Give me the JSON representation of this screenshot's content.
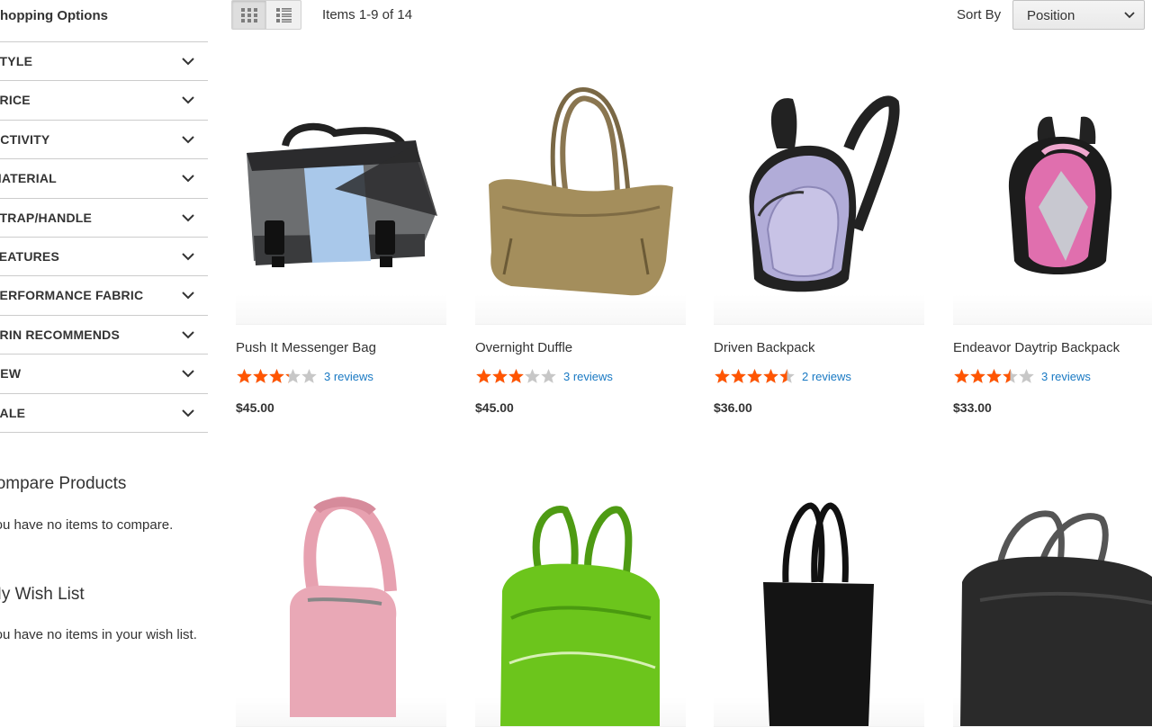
{
  "sidebar": {
    "title": "Shopping Options",
    "filters": [
      {
        "label": "STYLE"
      },
      {
        "label": "PRICE"
      },
      {
        "label": "ACTIVITY"
      },
      {
        "label": "MATERIAL"
      },
      {
        "label": "STRAP/HANDLE"
      },
      {
        "label": "FEATURES"
      },
      {
        "label": "PERFORMANCE FABRIC"
      },
      {
        "label": "ERIN RECOMMENDS"
      },
      {
        "label": "NEW"
      },
      {
        "label": "SALE"
      }
    ],
    "compare": {
      "title": "Compare Products",
      "empty": "You have no items to compare."
    },
    "wishlist": {
      "title": "My Wish List",
      "empty": "You have no items in your wish list."
    }
  },
  "toolbar": {
    "view_modes": [
      {
        "name": "grid",
        "icon": "grid-icon",
        "active": true
      },
      {
        "name": "list",
        "icon": "list-icon",
        "active": false
      }
    ],
    "amount": "Items 1-9 of 14",
    "sort_label": "Sort By",
    "sort_value": "Position"
  },
  "colors": {
    "star": "#ff5501",
    "star_empty": "#c7c7c7",
    "link": "#1979c3",
    "border": "#cccccc"
  },
  "products": [
    {
      "name": "Push It Messenger Bag",
      "rating": 0.65,
      "reviews": "3 reviews",
      "price": "$45.00",
      "image": "messenger-bag"
    },
    {
      "name": "Overnight Duffle",
      "rating": 0.6,
      "reviews": "3 reviews",
      "price": "$45.00",
      "image": "duffle-bag"
    },
    {
      "name": "Driven Backpack",
      "rating": 0.9,
      "reviews": "2 reviews",
      "price": "$36.00",
      "image": "backpack-lavender"
    },
    {
      "name": "Endeavor Daytrip Backpack",
      "rating": 0.7,
      "reviews": "3 reviews",
      "price": "$33.00",
      "image": "backpack-pink"
    },
    {
      "image": "shoulder-bag-pink"
    },
    {
      "image": "gym-bag-green"
    },
    {
      "image": "tote-black"
    },
    {
      "image": "duffle-black"
    }
  ]
}
